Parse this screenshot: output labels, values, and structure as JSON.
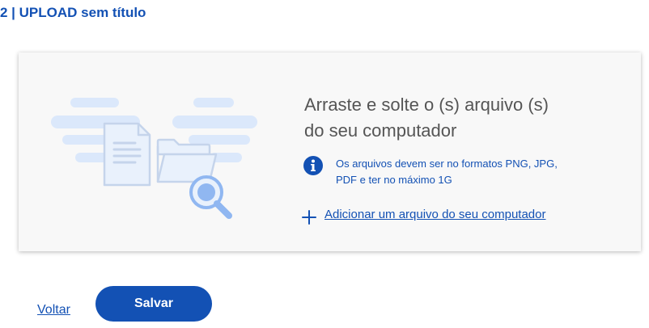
{
  "header": {
    "step_title": "2 | UPLOAD sem título"
  },
  "upload": {
    "drop_line_1": "Arraste e solte o (s) arquivo (s)",
    "drop_line_2": "do seu computador",
    "info_icon": "info-circle-icon",
    "info_line_1": "Os arquivos devem ser no formatos PNG, JPG,",
    "info_line_2": "PDF e ter no máximo 1G",
    "add_icon": "plus-icon",
    "add_label": "Adicionar um arquivo do seu computador",
    "illustration_icons": [
      "cloud-icon",
      "document-icon",
      "folder-icon",
      "magnifier-icon"
    ]
  },
  "actions": {
    "back_label": "Voltar",
    "save_label": "Salvar"
  },
  "colors": {
    "primary": "#1351b4",
    "text_muted": "#555555",
    "card_bg": "#f8f8f8",
    "illustration_light": "#dbe8fb",
    "illustration_mid": "#c5d4eb",
    "illustration_accent": "#90b7f1"
  }
}
